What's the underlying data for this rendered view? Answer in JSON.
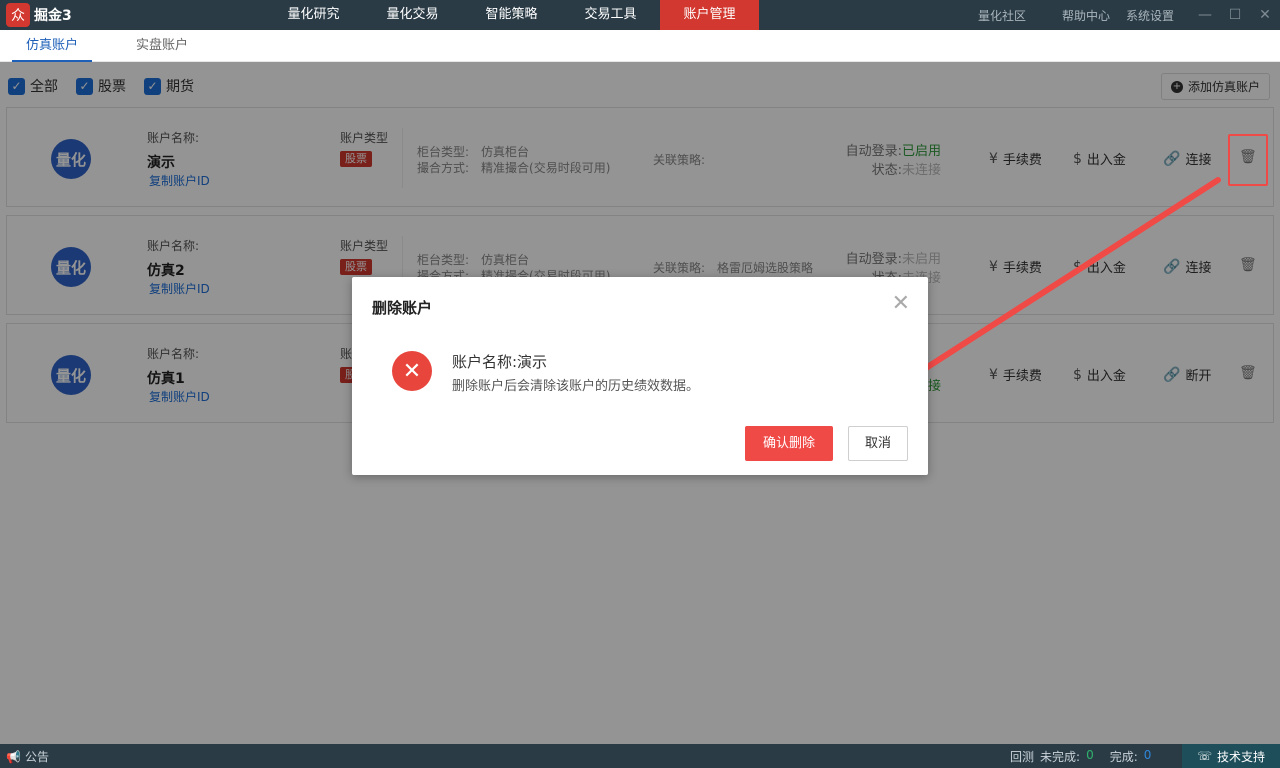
{
  "app": {
    "logo_text": "掘金3",
    "logo_mark": "众"
  },
  "nav": [
    "量化研究",
    "量化交易",
    "智能策略",
    "交易工具",
    "账户管理"
  ],
  "sys_links": [
    "量化社区",
    "帮助中心",
    "系统设置"
  ],
  "window_controls": {
    "minimize": "—",
    "maximize": "☐",
    "close": "✕"
  },
  "subtabs": [
    "仿真账户",
    "实盘账户"
  ],
  "filters": [
    {
      "label": "全部",
      "checked": true
    },
    {
      "label": "股票",
      "checked": true
    },
    {
      "label": "期货",
      "checked": true
    }
  ],
  "add_account": "添加仿真账户",
  "labels": {
    "account_name": "账户名称:",
    "copy_id": "复制账户ID",
    "account_type": "账户类型",
    "counter_type": "柜台类型:",
    "match_mode": "撮合方式:",
    "linked_strategy": "关联策略:",
    "auto_login": "自动登录:",
    "status": "状态:",
    "fee": "手续费",
    "deposit": "出入金",
    "trash_icon": "delete-icon"
  },
  "accounts": [
    {
      "avatar": "量化",
      "name": "演示",
      "type_tag": "股票",
      "counter": "仿真柜台",
      "match": "精准撮合(交易时段可用)",
      "strategy": "",
      "auto_login": "已启用",
      "auto_on": true,
      "status": "未连接",
      "connect": "连接"
    },
    {
      "avatar": "量化",
      "name": "仿真2",
      "type_tag": "股票",
      "counter": "仿真柜台",
      "match": "精准撮合(交易时段可用)",
      "strategy": "格雷厄姆选股策略",
      "auto_login": "未启用",
      "auto_on": false,
      "status": "未连接",
      "connect": "连接"
    },
    {
      "avatar": "量化",
      "name": "仿真1",
      "type_tag": "股票",
      "counter": "",
      "match": "",
      "strategy": "",
      "auto_login": "",
      "auto_on": true,
      "status": "已连接",
      "connect": "断开"
    }
  ],
  "dialog": {
    "title": "删除账户",
    "close": "✕",
    "icon": "✕",
    "line1": "账户名称:演示",
    "line2": "删除账户后会清除该账户的历史绩效数据。",
    "confirm": "确认删除",
    "cancel": "取消"
  },
  "footer": {
    "notice": "公告",
    "backtest": "回测",
    "incomplete_label": "未完成:",
    "incomplete": "0",
    "complete_label": "完成:",
    "complete": "0",
    "support": "技术支持"
  },
  "colors": {
    "accent": "#d2382f",
    "primary": "#1e6fd9",
    "highlight": "#f04a47",
    "success": "#2e9a3a"
  }
}
